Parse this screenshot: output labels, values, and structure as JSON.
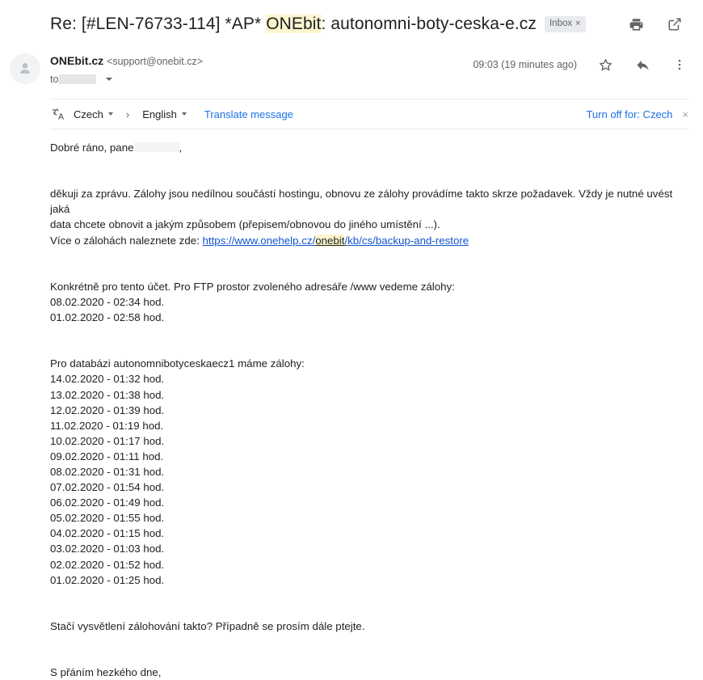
{
  "header": {
    "subject_prefix": "Re: [#LEN-76733-114] *AP* ",
    "subject_highlight": "ONEbit",
    "subject_suffix": ": autonomni-boty-ceska-e.cz",
    "inbox_label": "Inbox",
    "inbox_close": "×",
    "print_icon": "print-icon",
    "open_new_window_icon": "open-in-new-window-icon"
  },
  "sender": {
    "avatar_icon": "person-avatar-icon",
    "name": "ONEbit.cz",
    "email": "<support@onebit.cz>",
    "to_label": "to",
    "to_recipient_redacted": "",
    "recipient_details_caret": "chevron-down-icon",
    "timestamp": "09:03 (19 minutes ago)",
    "star_icon": "star-icon",
    "reply_icon": "reply-arrow-icon",
    "more_icon": "more-vertical-icon"
  },
  "translate": {
    "icon": "translate-icon",
    "source_language": "Czech",
    "arrow": "›",
    "target_language": "English",
    "translate_action": "Translate message",
    "turn_off": "Turn off for: Czech",
    "close": "×"
  },
  "body": {
    "greeting_prefix": "Dobré ráno, pane",
    "greeting_suffix": ",",
    "paragraph1_line1": "děkuji za zprávu. Zálohy jsou nedílnou součástí hostingu, obnovu ze zálohy provádíme takto skrze požadavek. Vždy je nutné uvést jaká",
    "paragraph1_line2": "data chcete obnovit a jakým způsobem (přepisem/obnovou do jiného umístění ...).",
    "link_intro": "Více o zálohách naleznete zde: ",
    "link_part1": "https://www.onehelp.cz/",
    "link_highlight": "onebit",
    "link_part2": "/kb/cs/backup-and-restore",
    "ftp_heading": "Konkrétně pro tento účet. Pro FTP prostor zvoleného adresáře /www vedeme zálohy:",
    "ftp_backups": [
      "08.02.2020 - 02:34 hod.",
      "01.02.2020 - 02:58 hod."
    ],
    "db_heading": "Pro databázi autonomnibotyceskaecz1 máme zálohy:",
    "db_backups": [
      "14.02.2020 - 01:32 hod.",
      "13.02.2020 - 01:38 hod.",
      "12.02.2020 - 01:39 hod.",
      "11.02.2020 - 01:19 hod.",
      "10.02.2020 - 01:17 hod.",
      "09.02.2020 - 01:11 hod.",
      "08.02.2020 - 01:31 hod.",
      "07.02.2020 - 01:54 hod.",
      "06.02.2020 - 01:49 hod.",
      "05.02.2020 - 01:55 hod.",
      "04.02.2020 - 01:15 hod.",
      "03.02.2020 - 01:03 hod.",
      "02.02.2020 - 01:52 hod.",
      "01.02.2020 - 01:25 hod."
    ],
    "closing_question": "Stačí vysvětlení zálohování takto? Případně se prosím dále ptejte.",
    "signoff": "S přáním hezkého dne,"
  },
  "colors": {
    "link": "#1155cc",
    "action_link": "#1a73e8",
    "highlight": "#fdf5cf",
    "text": "#202124",
    "muted": "#5f6368"
  }
}
